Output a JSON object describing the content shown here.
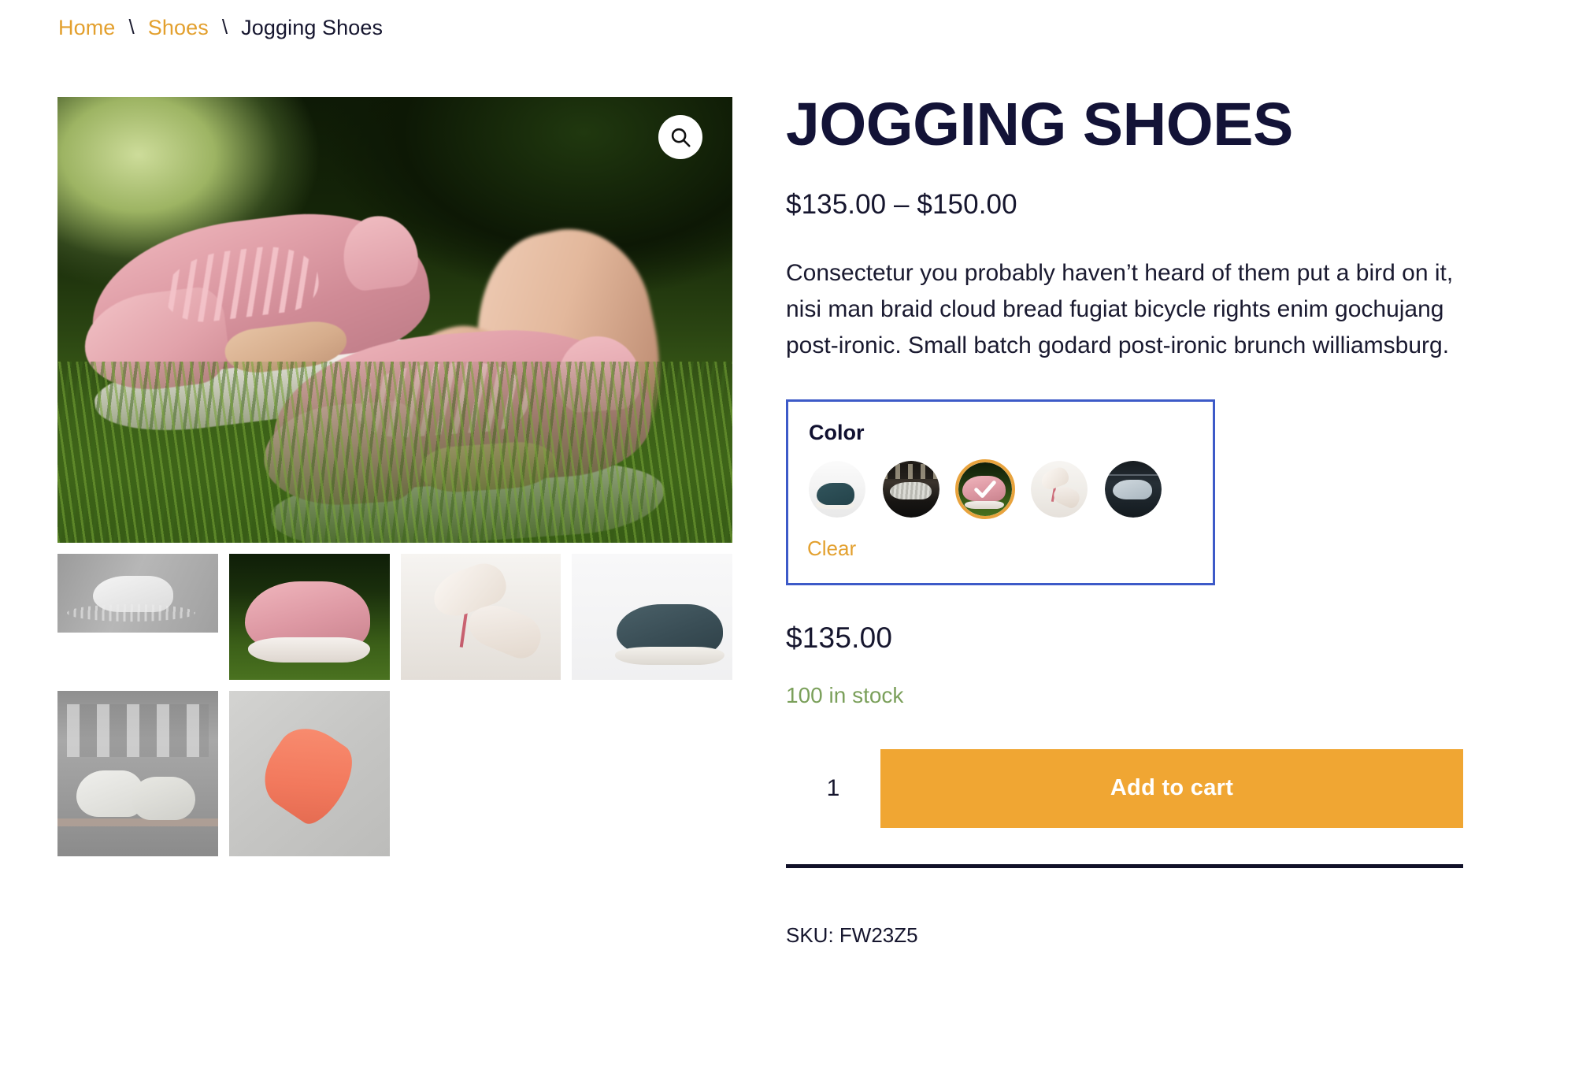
{
  "breadcrumb": {
    "separator": "\\",
    "items": [
      {
        "label": "Home",
        "type": "link"
      },
      {
        "label": "Shoes",
        "type": "link"
      },
      {
        "label": "Jogging Shoes",
        "type": "current"
      }
    ]
  },
  "gallery": {
    "zoom_icon": "search-icon",
    "main_image_alt": "Pink jogging shoes on grass",
    "thumbnails": [
      {
        "alt": "White sneakers splashing in water"
      },
      {
        "alt": "Pink jogging shoes on grass"
      },
      {
        "alt": "Pastel sneakers on white pedestal"
      },
      {
        "alt": "Teal and white sneaker on light background"
      },
      {
        "alt": "Beige knit sneakers on a bench"
      },
      {
        "alt": "Coral running shoe on concrete"
      }
    ]
  },
  "product": {
    "title": "Jogging Shoes",
    "price_range": "$135.00 – $150.00",
    "description": "Consectetur you probably haven’t heard of them put a bird on it, nisi man braid cloud bread fugiat bicycle rights enim gochujang post-ironic. Small batch godard post-ironic brunch williamsburg.",
    "selected_price": "$135.00",
    "stock_status": "100 in stock",
    "sku_label": "SKU: FW23Z5"
  },
  "variations": {
    "attribute_label": "Color",
    "clear_label": "Clear",
    "selected_index": 2,
    "swatches": [
      {
        "name": "teal-sneaker-swatch",
        "selected": false
      },
      {
        "name": "patterned-sneaker-swatch",
        "selected": false
      },
      {
        "name": "pink-jogging-shoe-swatch",
        "selected": true
      },
      {
        "name": "pastel-sneaker-swatch",
        "selected": false
      },
      {
        "name": "grey-sneaker-swatch",
        "selected": false
      }
    ]
  },
  "cart": {
    "quantity_value": "1",
    "quantity_placeholder": "1",
    "add_to_cart_label": "Add to cart"
  },
  "colors": {
    "accent_orange": "#e3a02e",
    "button_orange": "#f0a633",
    "title_navy": "#131337",
    "focus_blue": "#3d5ac8",
    "stock_green": "#7ba05b",
    "selected_ring": "#e8a33d"
  }
}
